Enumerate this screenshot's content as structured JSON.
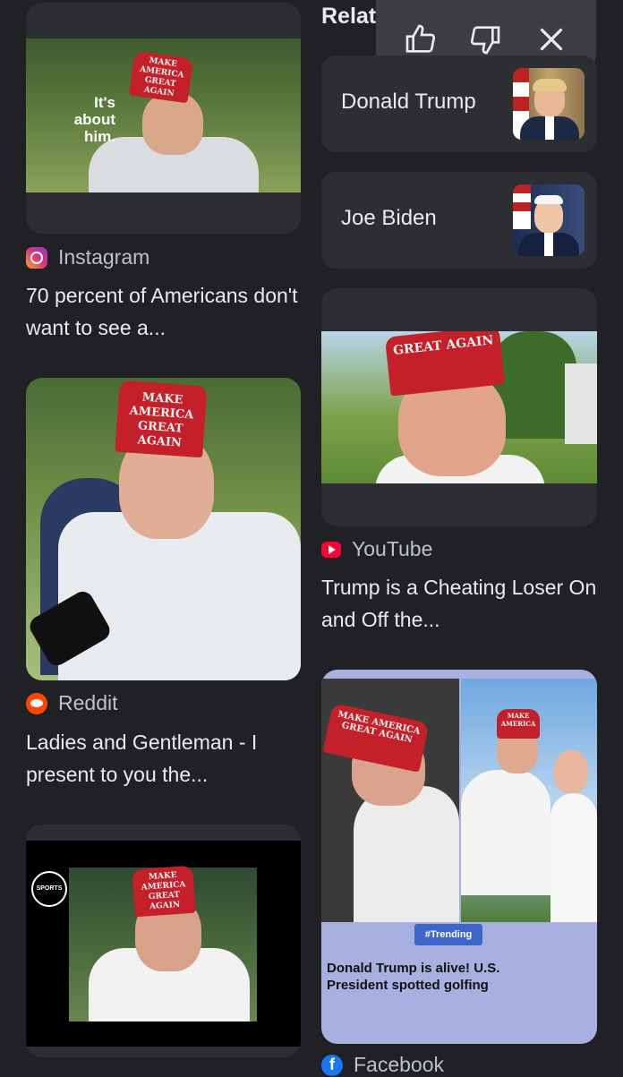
{
  "related_header": "Relat",
  "feedback": {
    "like_icon": "thumbs-up-icon",
    "dislike_icon": "thumbs-down-icon",
    "close_icon": "close-icon"
  },
  "related": [
    {
      "label": "Donald Trump"
    },
    {
      "label": "Joe Biden"
    }
  ],
  "results": [
    {
      "source": "Instagram",
      "title": "70 percent of Americans don't want to see a...",
      "overlay": "It's about him.",
      "hat": "MAKE AMERICA GREAT AGAIN"
    },
    {
      "source": "YouTube",
      "title": "Trump is a Cheating Loser On and Off the...",
      "hat": "GREAT AGAIN"
    },
    {
      "source": "Reddit",
      "title": "Ladies and Gentleman - I present to you the...",
      "hat": "MAKE AMERICA GREAT AGAIN"
    },
    {
      "source": "Facebook",
      "badge": "#Trending",
      "caption": "Donald Trump is alive! U.S. President spotted golfing",
      "hat": "MAKE AMERICA GREAT AGAIN"
    },
    {
      "logo": "SPORTS",
      "hat": "MAKE AMERICA GREAT AGAIN"
    }
  ],
  "colors": {
    "background": "#202124",
    "card": "#2d2e31",
    "text": "#e8eaed",
    "muted": "#bdc1c6"
  }
}
